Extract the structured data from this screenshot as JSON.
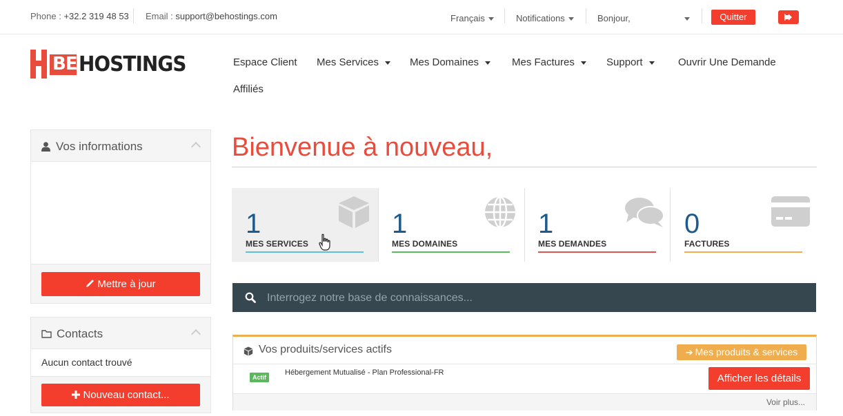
{
  "topbar": {
    "phone_label": "Phone : ",
    "phone_value": "+32.2 319 48 53",
    "email_label": "Email : ",
    "email_value": "support@behostings.com",
    "language": "Français",
    "notifications": "Notifications",
    "greeting": "Bonjour,",
    "quit_label": "Quitter"
  },
  "logo": {
    "mark": "BE",
    "text": "HOSTINGS"
  },
  "nav": [
    {
      "label": "Espace Client",
      "dropdown": false
    },
    {
      "label": "Mes Services",
      "dropdown": true
    },
    {
      "label": "Mes Domaines",
      "dropdown": true
    },
    {
      "label": "Mes Factures",
      "dropdown": true
    },
    {
      "label": "Support",
      "dropdown": true
    },
    {
      "label": "Ouvrir Une Demande",
      "dropdown": false
    },
    {
      "label": "Affiliés",
      "dropdown": false
    }
  ],
  "sidebar": {
    "info_title": "Vos informations",
    "update_label": "Mettre à jour",
    "contacts_title": "Contacts",
    "no_contact": "Aucun contact trouvé",
    "new_contact_label": "Nouveau contact..."
  },
  "main": {
    "welcome": "Bienvenue à nouveau,",
    "stats": [
      {
        "value": "1",
        "label": "MES SERVICES",
        "color": "#5bc0de",
        "icon": "cube-icon"
      },
      {
        "value": "1",
        "label": "MES DOMAINES",
        "color": "#5cb85c",
        "icon": "globe-icon"
      },
      {
        "value": "1",
        "label": "MES DEMANDES",
        "color": "#d9534f",
        "icon": "comments-icon"
      },
      {
        "value": "0",
        "label": "FACTURES",
        "color": "#f0ad4e",
        "icon": "credit-card-icon"
      }
    ],
    "kb_placeholder": "Interrogez notre base de connaissances...",
    "products": {
      "title": "Vos produits/services actifs",
      "all_label": "Mes produits & services",
      "items": [
        {
          "status": "Actif",
          "name": "Hébergement Mutualisé - Plan Professional-FR",
          "action": "Afficher les détails"
        }
      ],
      "more_label": "Voir plus..."
    }
  },
  "colors": {
    "accent": "#f33e2e",
    "heading": "#e74c3c",
    "number": "#1e5b8c",
    "kb_bg": "#37474f",
    "warning": "#f0ad4e"
  }
}
